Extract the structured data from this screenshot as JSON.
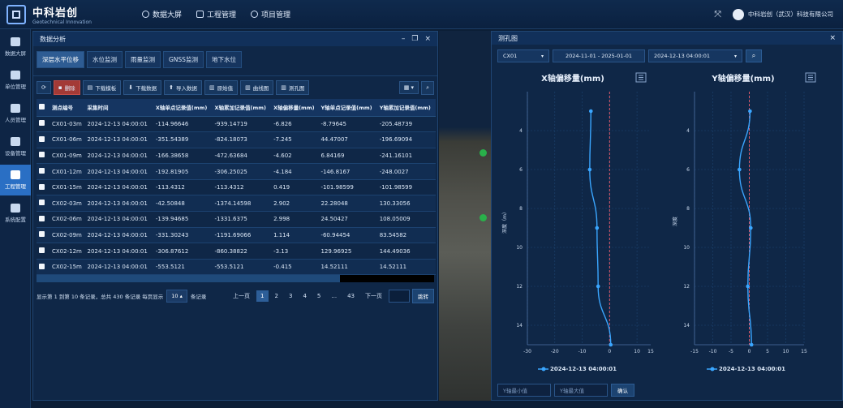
{
  "app": {
    "logo_cn": "中科岩创",
    "logo_en": "Geotechnical Innovation",
    "nav": [
      "数据大屏",
      "工程管理",
      "项目管理"
    ],
    "company": "中科岩创（武汉）科技有限公司"
  },
  "sidebar": {
    "items": [
      {
        "label": "数据大屏"
      },
      {
        "label": "单位管理"
      },
      {
        "label": "人员管理"
      },
      {
        "label": "设备管理"
      },
      {
        "label": "工程管理"
      },
      {
        "label": "系统配置"
      }
    ]
  },
  "analysis": {
    "title": "数据分析",
    "tabs": [
      "深层水平位移",
      "水位监测",
      "雨量监测",
      "GNSS监测",
      "地下水位"
    ],
    "toolbar": {
      "delete": "删除",
      "download_template": "下载模板",
      "download_data": "下载数据",
      "import_data": "导入数据",
      "raw_value": "原始值",
      "curve": "曲线图",
      "borehole": "测孔图"
    },
    "columns": [
      "测点编号",
      "采集时间",
      "X轴单点记录值(mm)",
      "X轴累加记录值(mm)",
      "X轴偏移量(mm)",
      "Y轴单点记录值(mm)",
      "Y轴累加记录值(mm)"
    ],
    "rows": [
      [
        "CX01-03m",
        "2024-12-13 04:00:01",
        "-114.96646",
        "-939.14719",
        "-6.826",
        "-8.79645",
        "-205.48739"
      ],
      [
        "CX01-06m",
        "2024-12-13 04:00:01",
        "-351.54389",
        "-824.18073",
        "-7.245",
        "44.47007",
        "-196.69094"
      ],
      [
        "CX01-09m",
        "2024-12-13 04:00:01",
        "-166.38658",
        "-472.63684",
        "-4.602",
        "6.84169",
        "-241.16101"
      ],
      [
        "CX01-12m",
        "2024-12-13 04:00:01",
        "-192.81905",
        "-306.25025",
        "-4.184",
        "-146.8167",
        "-248.0027"
      ],
      [
        "CX01-15m",
        "2024-12-13 04:00:01",
        "-113.4312",
        "-113.4312",
        "0.419",
        "-101.98599",
        "-101.98599"
      ],
      [
        "CX02-03m",
        "2024-12-13 04:00:01",
        "-42.50848",
        "-1374.14598",
        "2.902",
        "22.28048",
        "130.33056"
      ],
      [
        "CX02-06m",
        "2024-12-13 04:00:01",
        "-139.94685",
        "-1331.6375",
        "2.998",
        "24.50427",
        "108.05009"
      ],
      [
        "CX02-09m",
        "2024-12-13 04:00:01",
        "-331.30243",
        "-1191.69066",
        "1.114",
        "-60.94454",
        "83.54582"
      ],
      [
        "CX02-12m",
        "2024-12-13 04:00:01",
        "-306.87612",
        "-860.38822",
        "-3.13",
        "129.96925",
        "144.49036"
      ],
      [
        "CX02-15m",
        "2024-12-13 04:00:01",
        "-553.5121",
        "-553.5121",
        "-0.415",
        "14.52111",
        "14.52111"
      ]
    ],
    "pager": {
      "summary": "显示第 1 到第 10 条记录，总共 430 条记录 每页显示",
      "page_size": "10",
      "suffix": "条记录",
      "prev": "上一页",
      "pages": [
        "1",
        "2",
        "3",
        "4",
        "5",
        "...",
        "43"
      ],
      "next": "下一页",
      "jump": "跳转"
    }
  },
  "borehole": {
    "title": "测孔图",
    "point": "CX01",
    "date_range": "2024-11-01 - 2025-01-01",
    "time": "2024-12-13 04:00:01",
    "y_min_placeholder": "Y轴最小值",
    "y_max_placeholder": "Y轴最大值",
    "confirm": "确认"
  },
  "chart_data": [
    {
      "type": "line",
      "title": "X轴偏移量(mm)",
      "ylabel": "深度（m）",
      "xlim": [
        -30,
        15
      ],
      "ylim": [
        15,
        2
      ],
      "xticks": [
        -30,
        -20,
        -10,
        0,
        10
      ],
      "yticks": [
        4,
        6,
        8,
        10,
        12,
        14
      ],
      "grid": true,
      "legend": "bottom",
      "series": [
        {
          "name": "2024-12-13 04:00:01",
          "x": [
            -6.826,
            -7.245,
            -4.602,
            -4.184,
            0.419
          ],
          "y": [
            3,
            6,
            9,
            12,
            15
          ]
        }
      ]
    },
    {
      "type": "line",
      "title": "Y轴偏移量(mm)",
      "ylabel": "深度",
      "xlim": [
        -15,
        15
      ],
      "ylim": [
        15,
        2
      ],
      "xticks": [
        -15,
        -10,
        -5,
        0,
        5,
        10,
        15
      ],
      "yticks": [
        4,
        6,
        8,
        10,
        12,
        14
      ],
      "grid": true,
      "legend": "bottom",
      "series": [
        {
          "name": "2024-12-13 04:00:01",
          "x": [
            0.2,
            -2.7,
            0.4,
            -0.4,
            0.6
          ],
          "y": [
            3,
            6,
            9,
            12,
            15
          ]
        }
      ]
    }
  ]
}
